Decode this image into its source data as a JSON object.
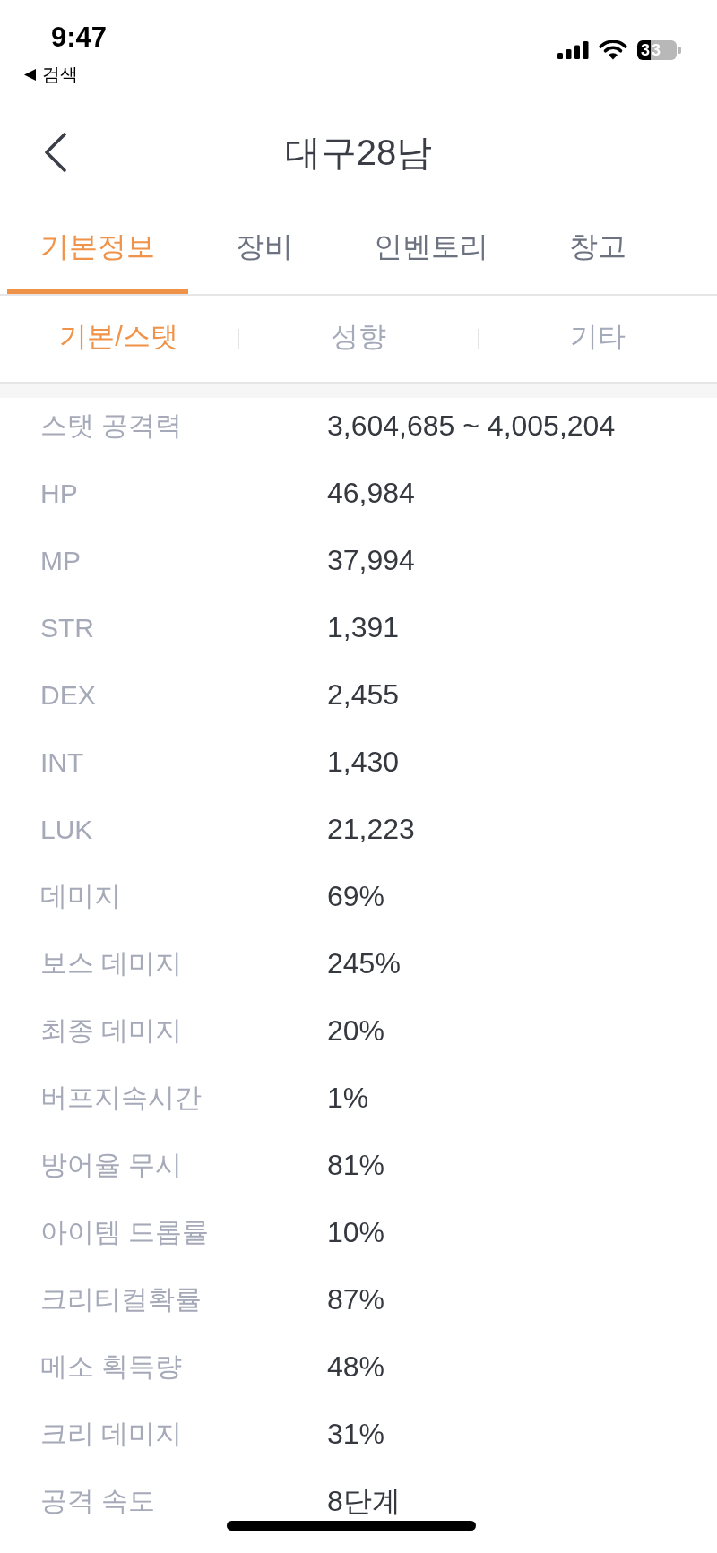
{
  "status_bar": {
    "time": "9:47",
    "back_link": "검색",
    "battery": "33"
  },
  "header": {
    "title": "대구28남"
  },
  "tabs": [
    {
      "label": "기본정보",
      "selected": true
    },
    {
      "label": "장비",
      "selected": false
    },
    {
      "label": "인벤토리",
      "selected": false
    },
    {
      "label": "창고",
      "selected": false
    }
  ],
  "sub_tabs": [
    {
      "label": "기본/스탯",
      "selected": true
    },
    {
      "label": "성향",
      "selected": false
    },
    {
      "label": "기타",
      "selected": false
    }
  ],
  "stats": [
    {
      "label": "스탯 공격력",
      "value": "3,604,685 ~ 4,005,204"
    },
    {
      "label": "HP",
      "value": "46,984"
    },
    {
      "label": "MP",
      "value": "37,994"
    },
    {
      "label": "STR",
      "value": "1,391"
    },
    {
      "label": "DEX",
      "value": "2,455"
    },
    {
      "label": "INT",
      "value": "1,430"
    },
    {
      "label": "LUK",
      "value": "21,223"
    },
    {
      "label": "데미지",
      "value": "69%"
    },
    {
      "label": "보스 데미지",
      "value": "245%"
    },
    {
      "label": "최종 데미지",
      "value": "20%"
    },
    {
      "label": "버프지속시간",
      "value": "1%"
    },
    {
      "label": "방어율 무시",
      "value": "81%"
    },
    {
      "label": "아이템 드롭률",
      "value": "10%"
    },
    {
      "label": "크리티컬확률",
      "value": "87%"
    },
    {
      "label": "메소 획득량",
      "value": "48%"
    },
    {
      "label": "크리 데미지",
      "value": "31%"
    },
    {
      "label": "공격 속도",
      "value": "8단계"
    }
  ]
}
